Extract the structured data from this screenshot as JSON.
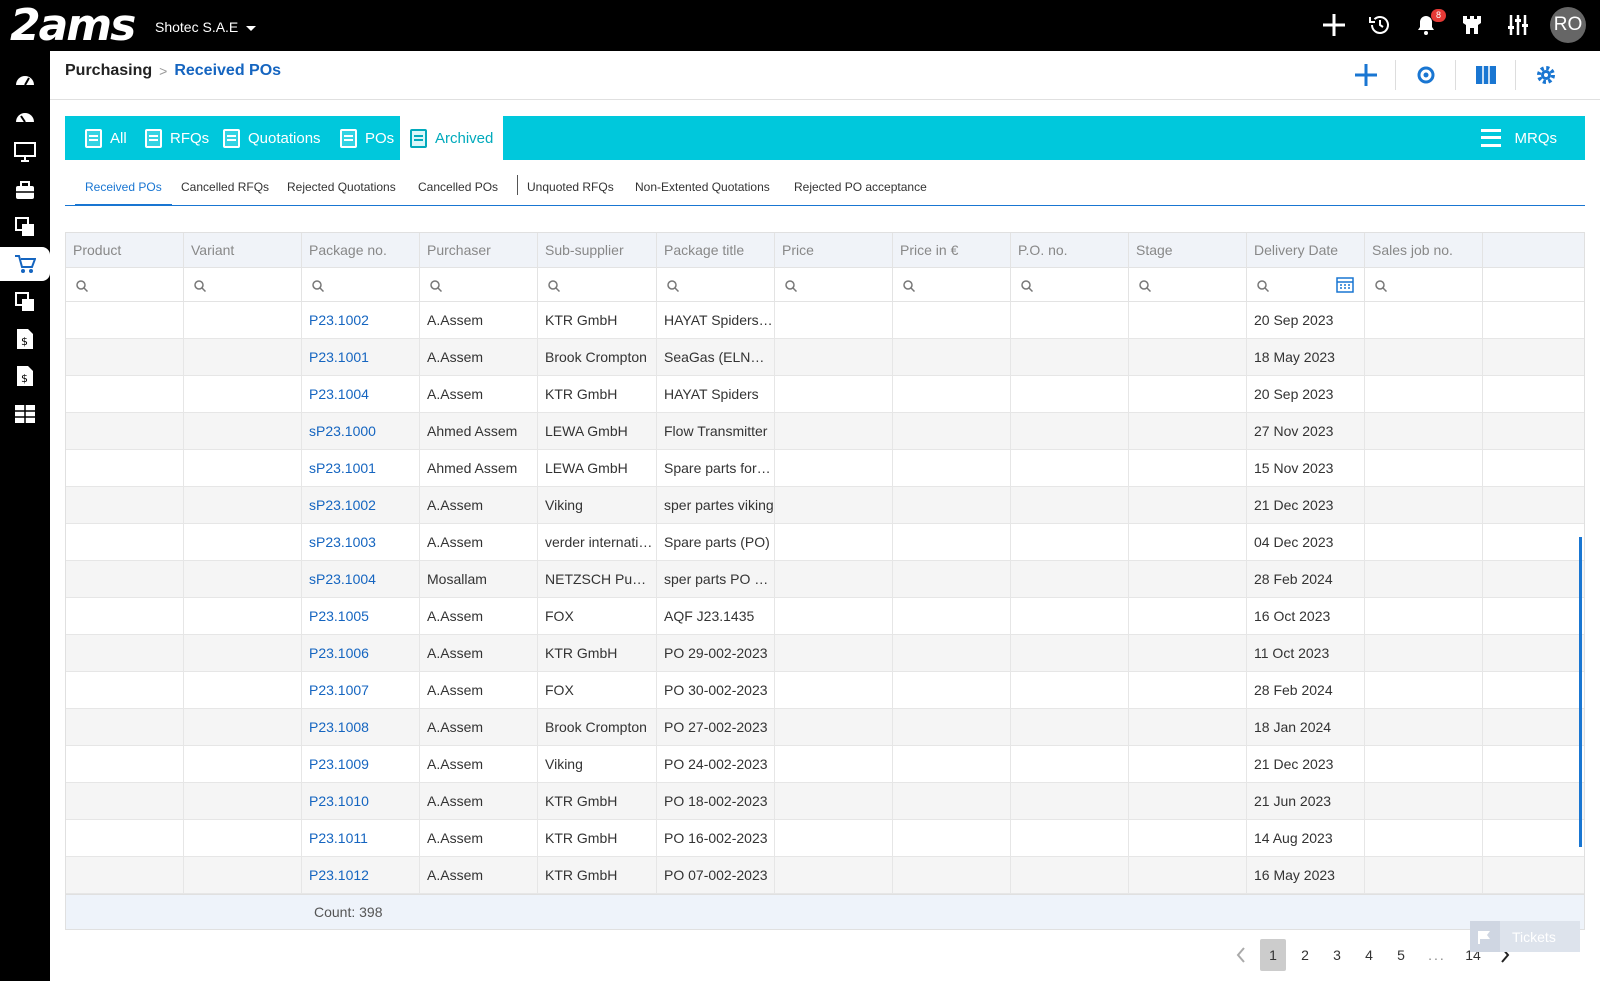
{
  "app": {
    "logo": "2ams",
    "company": "Shotec S.A.E"
  },
  "topbar": {
    "notifications_count": "8",
    "avatar_initials": "RO"
  },
  "breadcrumb": {
    "root": "Purchasing",
    "current": "Received POs"
  },
  "tabs": [
    {
      "label": "All"
    },
    {
      "label": "RFQs"
    },
    {
      "label": "Quotations"
    },
    {
      "label": "POs"
    },
    {
      "label": "Archived"
    }
  ],
  "mrqs_label": "MRQs",
  "subtabs": [
    "Received POs",
    "Cancelled RFQs",
    "Rejected Quotations",
    "Cancelled POs",
    "Unquoted RFQs",
    "Non-Extented Quotations",
    "Rejected PO acceptance"
  ],
  "columns": [
    "Product",
    "Variant",
    "Package no.",
    "Purchaser",
    "Sub-supplier",
    "Package title",
    "Price",
    "Price in €",
    "P.O. no.",
    "Stage",
    "Delivery Date",
    "Sales job no."
  ],
  "rows": [
    {
      "package_no": "P23.1002",
      "purchaser": "A.Assem",
      "supplier": "KTR GmbH",
      "title": "HAYAT Spiders spare parts",
      "delivery": "20 Sep 2023"
    },
    {
      "package_no": "P23.1001",
      "purchaser": "A.Assem",
      "supplier": "Brook Crompton",
      "title": "SeaGas (ELNG) motors",
      "delivery": "18 May 2023"
    },
    {
      "package_no": "P23.1004",
      "purchaser": "A.Assem",
      "supplier": "KTR GmbH",
      "title": "HAYAT Spiders",
      "delivery": "20 Sep 2023"
    },
    {
      "package_no": "sP23.1000",
      "purchaser": "Ahmed Assem",
      "supplier": "LEWA GmbH",
      "title": "Flow Transmitter",
      "delivery": "27 Nov 2023"
    },
    {
      "package_no": "sP23.1001",
      "purchaser": "Ahmed Assem",
      "supplier": "LEWA GmbH",
      "title": "Spare parts for LEWA",
      "delivery": "15 Nov 2023"
    },
    {
      "package_no": "sP23.1002",
      "purchaser": "A.Assem",
      "supplier": "Viking",
      "title": "sper partes viking",
      "delivery": "21 Dec 2023"
    },
    {
      "package_no": "sP23.1003",
      "purchaser": "A.Assem",
      "supplier": "verder international",
      "title": "Spare parts (PO)",
      "delivery": "04 Dec 2023"
    },
    {
      "package_no": "sP23.1004",
      "purchaser": "Mosallam",
      "supplier": "NETZSCH Pumpen",
      "title": "sper parts PO NETZSCH",
      "delivery": "28 Feb 2024"
    },
    {
      "package_no": "P23.1005",
      "purchaser": "A.Assem",
      "supplier": "FOX",
      "title": "AQF J23.1435",
      "delivery": "16 Oct 2023"
    },
    {
      "package_no": "P23.1006",
      "purchaser": "A.Assem",
      "supplier": "KTR GmbH",
      "title": "PO 29-002-2023",
      "delivery": "11 Oct 2023"
    },
    {
      "package_no": "P23.1007",
      "purchaser": "A.Assem",
      "supplier": "FOX",
      "title": "PO 30-002-2023",
      "delivery": "28 Feb 2024"
    },
    {
      "package_no": "P23.1008",
      "purchaser": "A.Assem",
      "supplier": "Brook Crompton",
      "title": "PO 27-002-2023",
      "delivery": "18 Jan 2024"
    },
    {
      "package_no": "P23.1009",
      "purchaser": "A.Assem",
      "supplier": "Viking",
      "title": "PO 24-002-2023",
      "delivery": "21 Dec 2023"
    },
    {
      "package_no": "P23.1010",
      "purchaser": "A.Assem",
      "supplier": "KTR GmbH",
      "title": "PO 18-002-2023",
      "delivery": "21 Jun 2023"
    },
    {
      "package_no": "P23.1011",
      "purchaser": "A.Assem",
      "supplier": "KTR GmbH",
      "title": "PO 16-002-2023",
      "delivery": "14 Aug 2023"
    },
    {
      "package_no": "P23.1012",
      "purchaser": "A.Assem",
      "supplier": "KTR GmbH",
      "title": "PO 07-002-2023",
      "delivery": "16 May 2023"
    }
  ],
  "footer": {
    "count": "Count: 398"
  },
  "pagination": {
    "pages": [
      "1",
      "2",
      "3",
      "4",
      "5"
    ],
    "dots": "...",
    "last": "14",
    "current": "1"
  },
  "tickets_label": "Tickets",
  "colors": {
    "accent": "#00c8dc",
    "link": "#1565c0",
    "primary": "#1976d2",
    "topbar": "#000000"
  }
}
